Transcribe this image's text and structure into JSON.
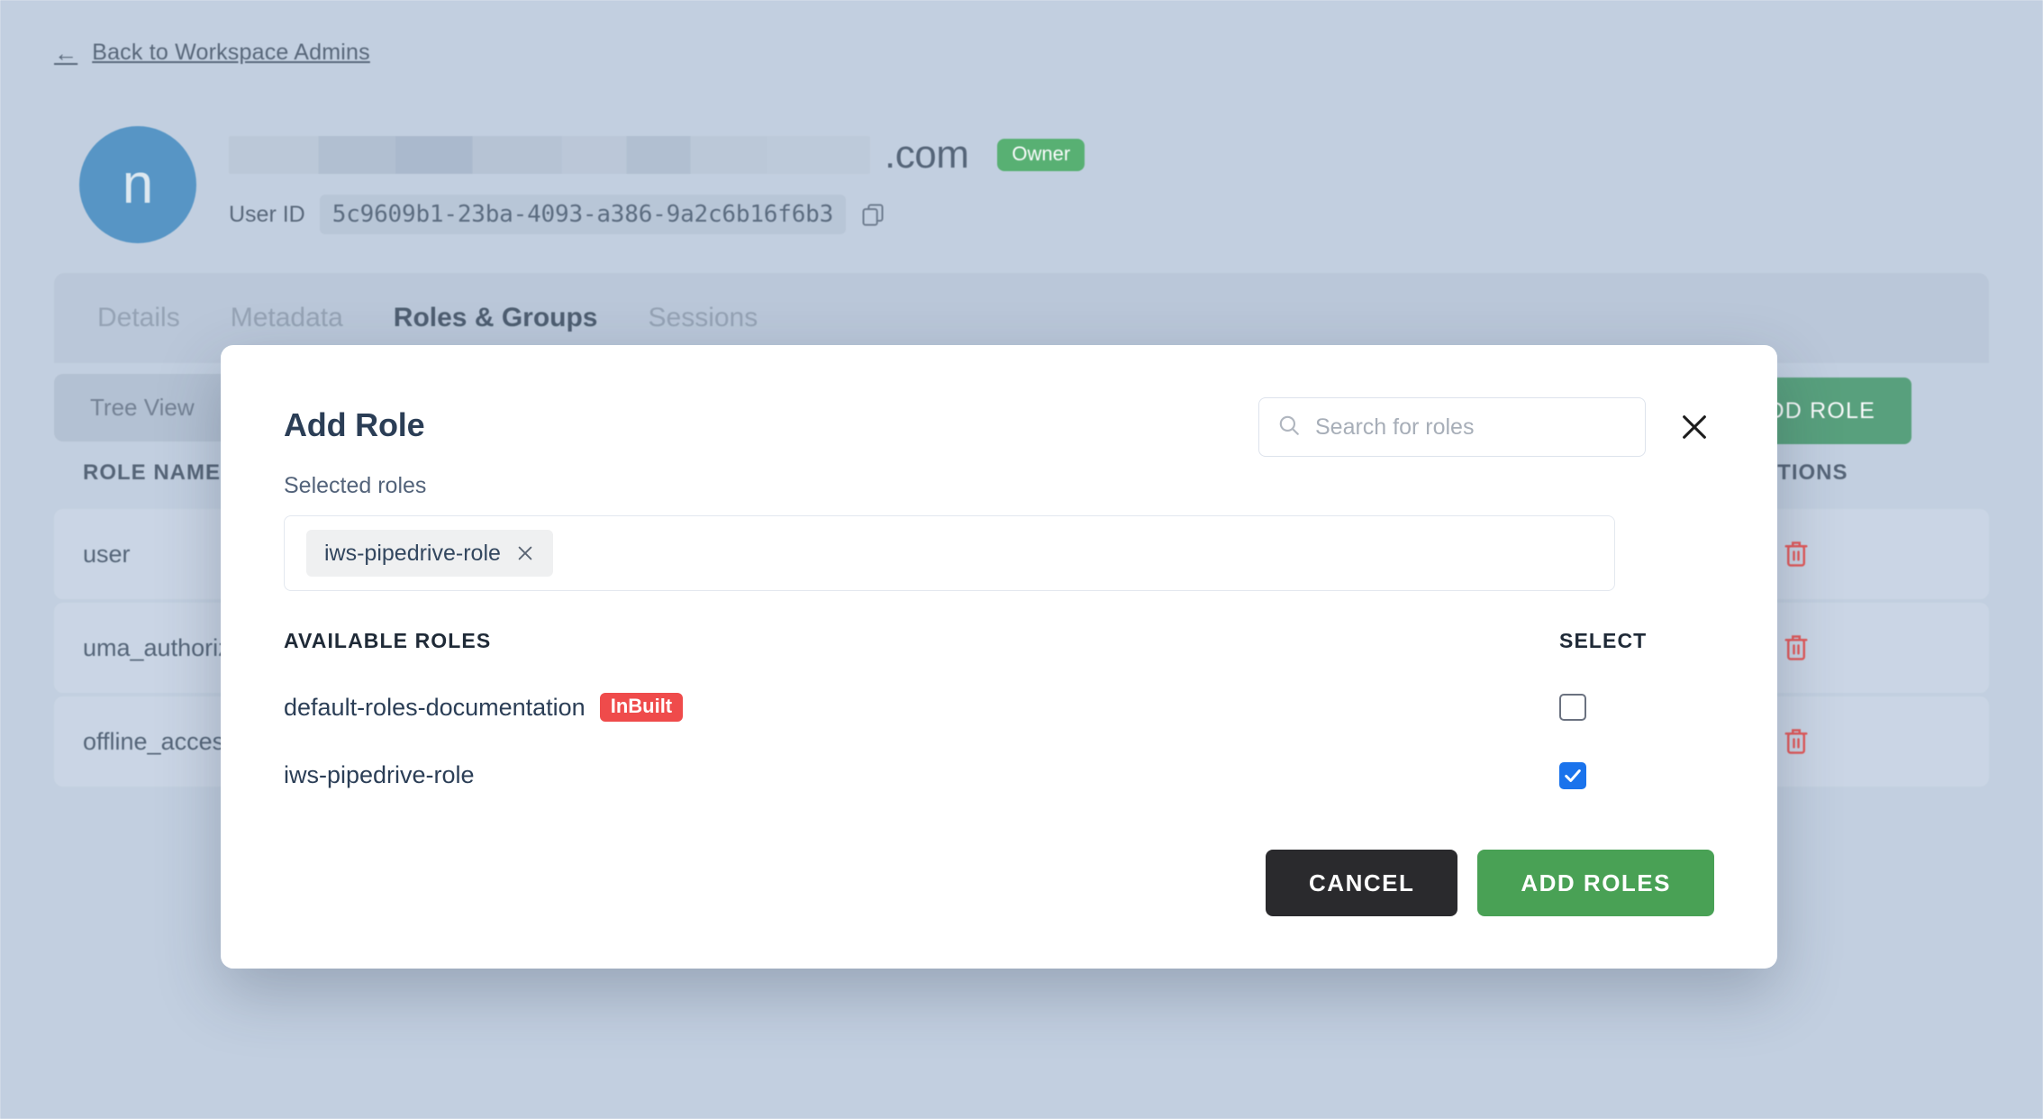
{
  "back_link": {
    "label": "Back to Workspace Admins",
    "icon": "arrow-left-icon"
  },
  "identity": {
    "avatar_initial": "n",
    "email_tld": ".com",
    "email_redacted": true,
    "owner_badge": "Owner",
    "user_id_label": "User ID",
    "user_id_value": "5c9609b1-23ba-4093-a386-9a2c6b16f6b3",
    "copy_icon": "copy-icon"
  },
  "tabs": [
    {
      "label": "Details",
      "active": false
    },
    {
      "label": "Metadata",
      "active": false
    },
    {
      "label": "Roles & Groups",
      "active": true
    },
    {
      "label": "Sessions",
      "active": false
    }
  ],
  "panel": {
    "tree_view_label": "Tree View",
    "add_role_label": "ADD ROLE",
    "add_role_icon": "plus-icon",
    "table": {
      "columns": [
        "ROLE NAME",
        "ACTIONS"
      ],
      "rows": [
        {
          "name": "user",
          "action_icon": "trash-icon"
        },
        {
          "name": "uma_authorization",
          "action_icon": "trash-icon"
        },
        {
          "name": "offline_access",
          "action_icon": "trash-icon"
        }
      ]
    }
  },
  "modal": {
    "title": "Add Role",
    "search": {
      "placeholder": "Search for roles",
      "value": "",
      "icon": "search-icon"
    },
    "close_icon": "close-icon",
    "selected_roles_label": "Selected roles",
    "selected_roles": [
      {
        "name": "iws-pipedrive-role",
        "remove_icon": "close-small-icon"
      }
    ],
    "available_header": {
      "name_col": "AVAILABLE ROLES",
      "select_col": "SELECT"
    },
    "available_roles": [
      {
        "name": "default-roles-documentation",
        "badge": "InBuilt",
        "checked": false
      },
      {
        "name": "iws-pipedrive-role",
        "badge": "",
        "checked": true
      }
    ],
    "cancel_label": "CANCEL",
    "submit_label": "ADD ROLES"
  },
  "colors": {
    "page_background": "#b7c6da",
    "avatar": "#2d7cb8",
    "owner_badge": "#2f9e4f",
    "add_role_green": "#2f8a5b",
    "submit_green": "#49a155",
    "cancel_dark": "#2a2a2d",
    "inbuilt_red": "#ef4b4b",
    "trash_red": "#e03131",
    "checkbox_blue": "#1a73ec",
    "text_primary": "#2b3e56",
    "text_muted": "#7d8da3"
  }
}
